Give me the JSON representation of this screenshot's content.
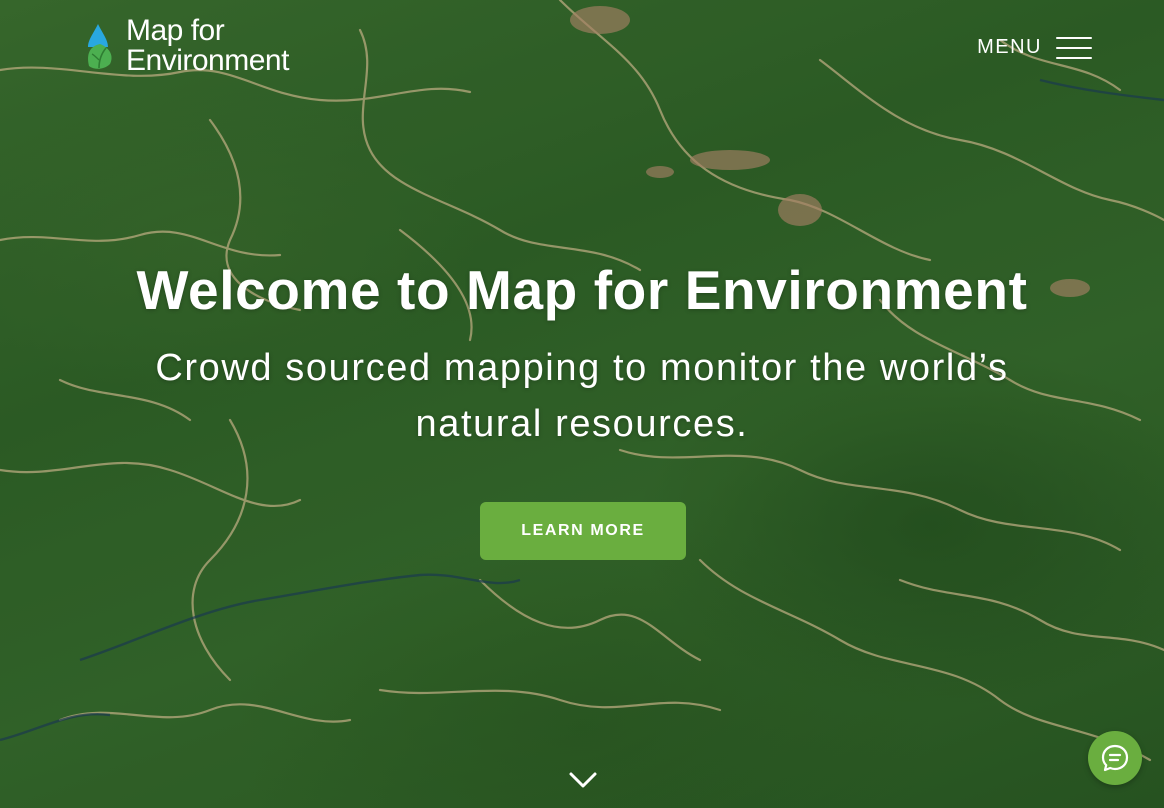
{
  "header": {
    "logo_line1": "Map for",
    "logo_line2": "Environment",
    "menu_label": "MENU"
  },
  "hero": {
    "title": "Welcome to Map for Environment",
    "subtitle": "Crowd sourced mapping to monitor the world’s natural resources.",
    "cta_label": "LEARN MORE"
  },
  "icons": {
    "logo": "water-drop-leaf-icon",
    "menu": "hamburger-icon",
    "scroll": "chevron-down-icon",
    "chat": "chat-bubble-icon"
  },
  "colors": {
    "accent": "#6aae3f",
    "text": "#ffffff",
    "drop_blue": "#29a8e0",
    "leaf_green": "#4caf50"
  }
}
